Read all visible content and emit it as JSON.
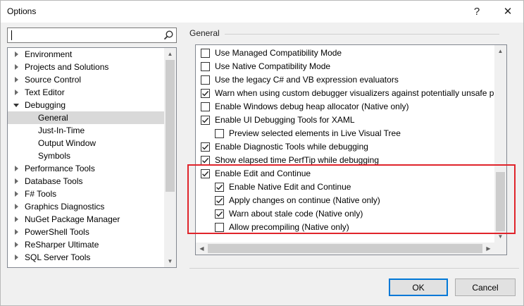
{
  "window": {
    "title": "Options",
    "help_label": "?",
    "close_label": "✕"
  },
  "search": {
    "value": "",
    "icon": "search-icon"
  },
  "tree": {
    "items": [
      {
        "label": "Environment",
        "level": 0,
        "expander": "collapsed"
      },
      {
        "label": "Projects and Solutions",
        "level": 0,
        "expander": "collapsed"
      },
      {
        "label": "Source Control",
        "level": 0,
        "expander": "collapsed"
      },
      {
        "label": "Text Editor",
        "level": 0,
        "expander": "collapsed"
      },
      {
        "label": "Debugging",
        "level": 0,
        "expander": "expanded"
      },
      {
        "label": "General",
        "level": 1,
        "expander": "none",
        "selected": true
      },
      {
        "label": "Just-In-Time",
        "level": 1,
        "expander": "none"
      },
      {
        "label": "Output Window",
        "level": 1,
        "expander": "none"
      },
      {
        "label": "Symbols",
        "level": 1,
        "expander": "none"
      },
      {
        "label": "Performance Tools",
        "level": 0,
        "expander": "collapsed"
      },
      {
        "label": "Database Tools",
        "level": 0,
        "expander": "collapsed"
      },
      {
        "label": "F# Tools",
        "level": 0,
        "expander": "collapsed"
      },
      {
        "label": "Graphics Diagnostics",
        "level": 0,
        "expander": "collapsed"
      },
      {
        "label": "NuGet Package Manager",
        "level": 0,
        "expander": "collapsed"
      },
      {
        "label": "PowerShell Tools",
        "level": 0,
        "expander": "collapsed"
      },
      {
        "label": "ReSharper Ultimate",
        "level": 0,
        "expander": "collapsed"
      },
      {
        "label": "SQL Server Tools",
        "level": 0,
        "expander": "collapsed"
      }
    ]
  },
  "general": {
    "group_label": "General",
    "options": [
      {
        "label": "Use Managed Compatibility Mode",
        "checked": false,
        "indent": 0
      },
      {
        "label": "Use Native Compatibility Mode",
        "checked": false,
        "indent": 0
      },
      {
        "label": "Use the legacy C# and VB expression evaluators",
        "checked": false,
        "indent": 0
      },
      {
        "label": "Warn when using custom debugger visualizers against potentially unsafe pro",
        "checked": true,
        "indent": 0
      },
      {
        "label": "Enable Windows debug heap allocator (Native only)",
        "checked": false,
        "indent": 0
      },
      {
        "label": "Enable UI Debugging Tools for XAML",
        "checked": true,
        "indent": 0
      },
      {
        "label": "Preview selected elements in Live Visual Tree",
        "checked": false,
        "indent": 1
      },
      {
        "label": "Enable Diagnostic Tools while debugging",
        "checked": true,
        "indent": 0
      },
      {
        "label": "Show elapsed time PerfTip while debugging",
        "checked": true,
        "indent": 0
      },
      {
        "label": "Enable Edit and Continue",
        "checked": true,
        "indent": 0
      },
      {
        "label": "Enable Native Edit and Continue",
        "checked": true,
        "indent": 1
      },
      {
        "label": "Apply changes on continue (Native only)",
        "checked": true,
        "indent": 1
      },
      {
        "label": "Warn about stale code (Native only)",
        "checked": true,
        "indent": 1
      },
      {
        "label": "Allow precompiling (Native only)",
        "checked": false,
        "indent": 1
      }
    ]
  },
  "buttons": {
    "ok": "OK",
    "cancel": "Cancel"
  },
  "colors": {
    "highlight_border": "#e0242b",
    "focus_border": "#0078d7"
  }
}
